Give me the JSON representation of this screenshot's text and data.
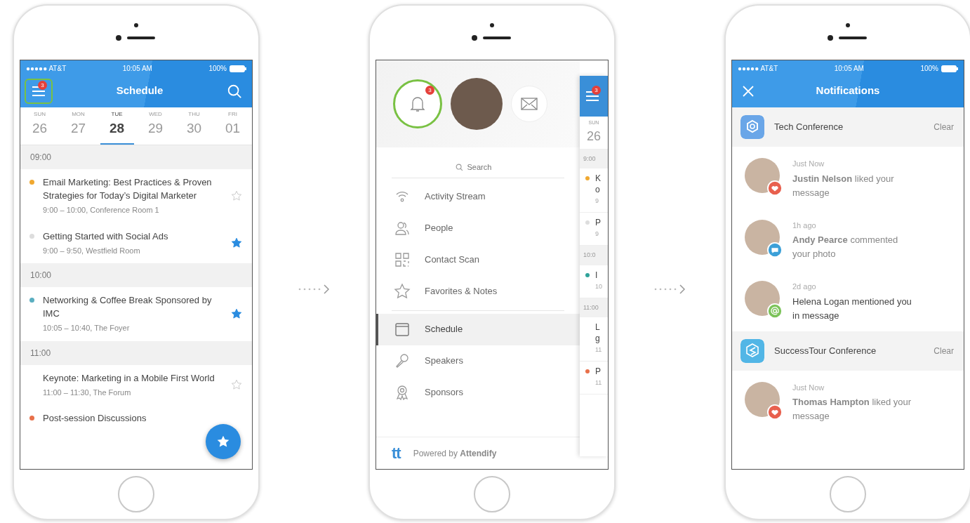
{
  "phones": [
    {
      "kind": "schedule",
      "status_bar": {
        "carrier": "●●●●● AT&T",
        "time": "10:05 AM",
        "battery": "100%"
      },
      "header": {
        "title": "Schedule",
        "menu_badge": "3",
        "highlighted": true
      },
      "days": [
        {
          "weekday": "SUN",
          "date": "26",
          "selected": false
        },
        {
          "weekday": "MON",
          "date": "27",
          "selected": false
        },
        {
          "weekday": "TUE",
          "date": "28",
          "selected": true
        },
        {
          "weekday": "WED",
          "date": "29",
          "selected": false
        },
        {
          "weekday": "THU",
          "date": "30",
          "selected": false
        },
        {
          "weekday": "FRI",
          "date": "01",
          "selected": false
        }
      ],
      "sections": [
        {
          "time": "09:00",
          "sessions": [
            {
              "title": "Email Marketing: Best Practices & Proven Strategies for Today’s Digital Marketer",
              "details": "9:00 – 10:00,  Conference Room 1",
              "color": "#f0a830",
              "favorite": false
            },
            {
              "title": "Getting Started with Social Ads",
              "details": "9:00 – 9:50,  Westfield Room",
              "color": "#dddddd",
              "favorite": true
            }
          ]
        },
        {
          "time": "10:00",
          "sessions": [
            {
              "title": "Networking & Coffee Break Sponsored by IMC",
              "details": "10:05 – 10:40,  The Foyer",
              "color": "#5aaec0",
              "favorite": true
            }
          ]
        },
        {
          "time": "11:00",
          "sessions": [
            {
              "title": "Keynote: Marketing in a Mobile First World",
              "details": "11:00 – 11:30,  The Forum",
              "favorite": false
            },
            {
              "title": "Post-session Discussions",
              "color": "#e8704a"
            }
          ]
        }
      ]
    },
    {
      "kind": "menu",
      "bell_badge": "3",
      "highlighted": true,
      "search": {
        "placeholder": "Search"
      },
      "menu_groups": [
        [
          {
            "label": "Activity Stream",
            "selected": false
          },
          {
            "label": "People",
            "selected": false
          },
          {
            "label": "Contact Scan",
            "selected": false
          },
          {
            "label": "Favorites & Notes",
            "selected": false
          }
        ],
        [
          {
            "label": "Schedule",
            "selected": true
          },
          {
            "label": "Speakers",
            "selected": false
          },
          {
            "label": "Sponsors",
            "selected": false
          }
        ]
      ],
      "footer": {
        "logo": "tt",
        "text": "Powered by **Attendify**"
      },
      "preview": {
        "menu_badge": "3",
        "weekday": "SUN",
        "date": "26",
        "rows": [
          {
            "kind": "time",
            "text": "9:00"
          },
          {
            "kind": "session",
            "color": "#f0a830",
            "lines": [
              "K",
              "o",
              "9"
            ]
          },
          {
            "kind": "session",
            "color": "#dddddd",
            "lines": [
              "P",
              "9"
            ]
          },
          {
            "kind": "time",
            "text": "10:0"
          },
          {
            "kind": "session",
            "color": "#2fa39a",
            "lines": [
              "I",
              "10"
            ]
          },
          {
            "kind": "time",
            "text": "11:00"
          },
          {
            "kind": "session",
            "lines": [
              "L",
              "g",
              "11"
            ]
          },
          {
            "kind": "session",
            "color": "#e8704a",
            "lines": [
              "P",
              "11"
            ]
          }
        ]
      }
    },
    {
      "kind": "notifications",
      "status_bar": {
        "carrier": "●●●●● AT&T",
        "time": "10:05 AM",
        "battery": "100%"
      },
      "header": {
        "title": "Notifications"
      },
      "groups": [
        {
          "name": "Tech Conference",
          "action": "Clear",
          "color": "#6aa6e8",
          "notifications": [
            {
              "time": "Just Now",
              "text": "**Justin Nelson** liked your message",
              "kind": "like",
              "unread": false
            },
            {
              "time": "1h ago",
              "text": "**Andy Pearce** commented your photo",
              "kind": "comment",
              "unread": false
            },
            {
              "time": "2d ago",
              "text": "Helena Logan mentioned you in message",
              "kind": "mention",
              "unread": true
            }
          ]
        },
        {
          "name": "SuccessTour Conference",
          "action": "Clear",
          "color": "#52b6e6",
          "notifications": [
            {
              "time": "Just Now",
              "text": "**Thomas Hampton** liked your message",
              "kind": "like",
              "unread": false
            }
          ]
        }
      ]
    }
  ]
}
